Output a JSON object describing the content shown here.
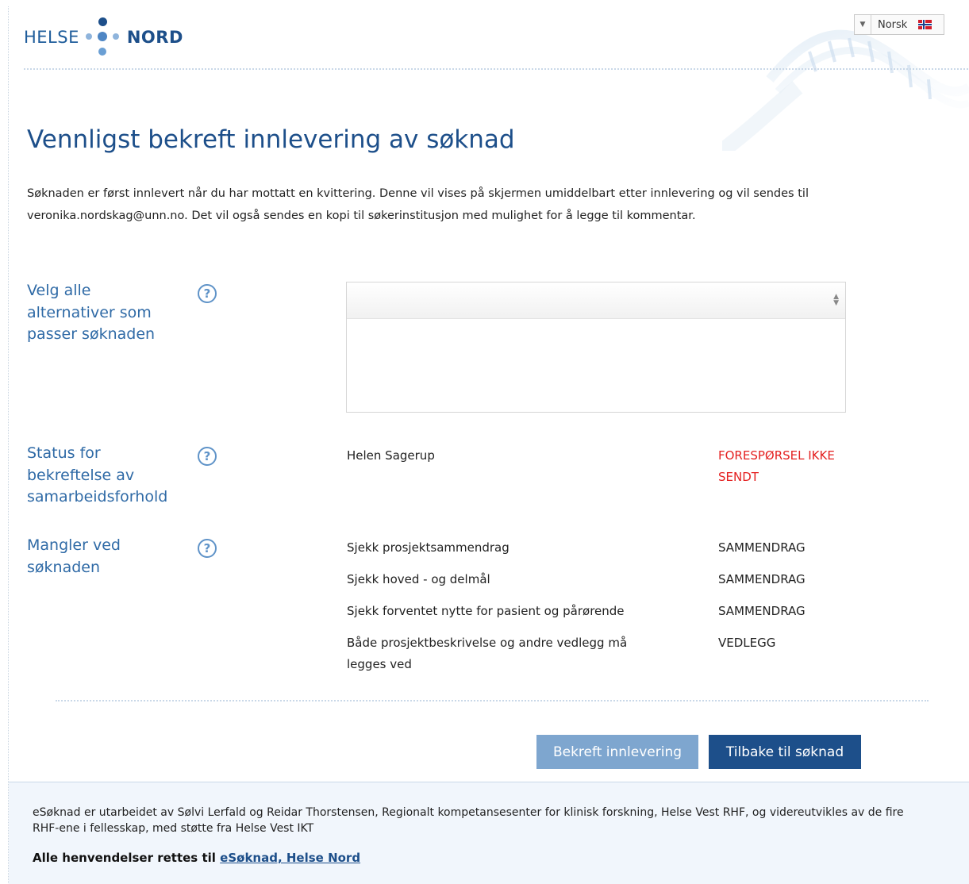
{
  "header": {
    "logo_left": "HELSE",
    "logo_right": "NORD",
    "language": {
      "selected": "Norsk",
      "flag_icon": "norway-flag-icon"
    }
  },
  "page": {
    "title": "Vennligst bekreft innlevering av søknad",
    "intro": "Søknaden er først innlevert når du har mottatt en kvittering. Denne vil vises på skjermen umiddelbart etter innlevering og vil sendes til veronika.nordskag@unn.no. Det vil også sendes en kopi til søkerinstitusjon med mulighet for å legge til kommentar."
  },
  "fields": {
    "options": {
      "label_lines": [
        "Velg alle",
        "alternativer som",
        "passer søknaden"
      ],
      "help": "?",
      "selected_value": ""
    },
    "collaboration": {
      "label_lines": [
        "Status for",
        "bekreftelse av",
        "samarbeidsforhold"
      ],
      "help": "?",
      "person": "Helen Sagerup",
      "status_lines": [
        "FORESPØRSEL IKKE",
        "SENDT"
      ]
    },
    "missing": {
      "label_lines": [
        "Mangler ved",
        "søknaden"
      ],
      "help": "?",
      "items": [
        {
          "text": "Sjekk prosjektsammendrag",
          "section": "SAMMENDRAG"
        },
        {
          "text": "Sjekk hoved - og delmål",
          "section": "SAMMENDRAG"
        },
        {
          "text": "Sjekk forventet nytte for pasient og pårørende",
          "section": "SAMMENDRAG"
        },
        {
          "text_lines": [
            "Både prosjektbeskrivelse og andre vedlegg må",
            "legges ved"
          ],
          "section": "VEDLEGG"
        }
      ]
    }
  },
  "buttons": {
    "confirm": "Bekreft innlevering",
    "back": "Tilbake til søknad"
  },
  "footer": {
    "text": "eSøknad er utarbeidet av Sølvi Lerfald og Reidar Thorstensen, Regionalt kompetansesenter for klinisk forskning, Helse Vest RHF, og videreutvikles av de fire RHF-ene i fellesskap, med støtte fra Helse Vest IKT",
    "contact_prefix": "Alle henvendelser rettes til",
    "contact_link": "eSøknad, Helse Nord"
  },
  "colors": {
    "brand_dark": "#1d4f8a",
    "brand_light": "#5f93c8",
    "status_red": "#e42020",
    "button_disabled": "#7ea6cf"
  }
}
